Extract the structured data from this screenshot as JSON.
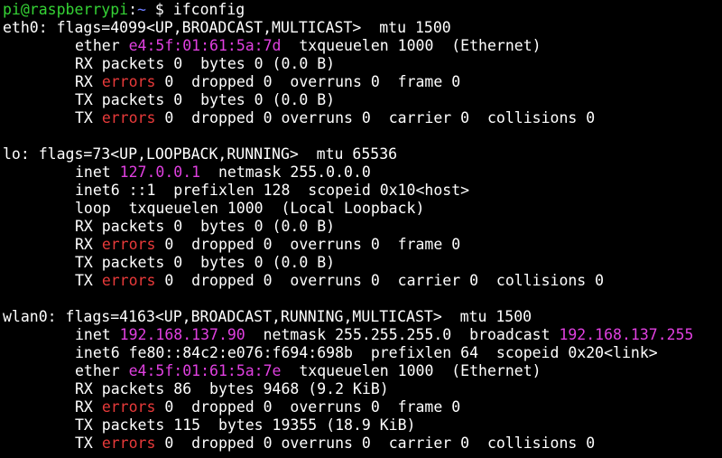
{
  "window": {
    "background": "#000000",
    "foreground": "#ffffff"
  },
  "colors": {
    "prompt_user": "#35d335",
    "prompt_path": "#6d7cff",
    "highlight_value": "#e040e0",
    "error_word": "#e83a3a"
  },
  "prompt": {
    "user_host": "pi@raspberrypi",
    "sep": ":",
    "path": "~",
    "symbol": " $ ",
    "command": "ifconfig"
  },
  "output": {
    "eth0": {
      "header": "eth0: flags=4099<UP,BROADCAST,MULTICAST>  mtu 1500",
      "ether_label": "ether ",
      "ether_mac": "e4:5f:01:61:5a:7d",
      "ether_rest": "  txqueuelen 1000  (Ethernet)",
      "rx_packets": "RX packets 0  bytes 0 (0.0 B)",
      "rx_err_pre": "RX ",
      "errors_word": "errors",
      "rx_err_rest": " 0  dropped 0  overruns 0  frame 0",
      "tx_packets": "TX packets 0  bytes 0 (0.0 B)",
      "tx_err_pre": "TX ",
      "tx_err_rest": " 0  dropped 0 overruns 0  carrier 0  collisions 0"
    },
    "lo": {
      "header": "lo: flags=73<UP,LOOPBACK,RUNNING>  mtu 65536",
      "inet_label": "inet ",
      "inet_addr": "127.0.0.1",
      "inet_rest": "  netmask 255.0.0.0",
      "inet6": "inet6 ::1  prefixlen 128  scopeid 0x10<host>",
      "loop": "loop  txqueuelen 1000  (Local Loopback)",
      "rx_packets": "RX packets 0  bytes 0 (0.0 B)",
      "rx_err_pre": "RX ",
      "errors_word": "errors",
      "rx_err_rest": " 0  dropped 0  overruns 0  frame 0",
      "tx_packets": "TX packets 0  bytes 0 (0.0 B)",
      "tx_err_pre": "TX ",
      "tx_err_rest": " 0  dropped 0  overruns 0  carrier 0  collisions 0"
    },
    "wlan0": {
      "header": "wlan0: flags=4163<UP,BROADCAST,RUNNING,MULTICAST>  mtu 1500",
      "inet_label": "inet ",
      "inet_addr": "192.168.137.90",
      "inet_mid": "  netmask 255.255.255.0  broadcast ",
      "broadcast_addr": "192.168.137.255",
      "inet6": "inet6 fe80::84c2:e076:f694:698b  prefixlen 64  scopeid 0x20<link>",
      "ether_label": "ether ",
      "ether_mac": "e4:5f:01:61:5a:7e",
      "ether_rest": "  txqueuelen 1000  (Ethernet)",
      "rx_packets": "RX packets 86  bytes 9468 (9.2 KiB)",
      "rx_err_pre": "RX ",
      "errors_word": "errors",
      "rx_err_rest": " 0  dropped 0  overruns 0  frame 0",
      "tx_packets": "TX packets 115  bytes 19355 (18.9 KiB)",
      "tx_err_pre": "TX ",
      "tx_err_rest": " 0  dropped 0 overruns 0  carrier 0  collisions 0"
    }
  }
}
